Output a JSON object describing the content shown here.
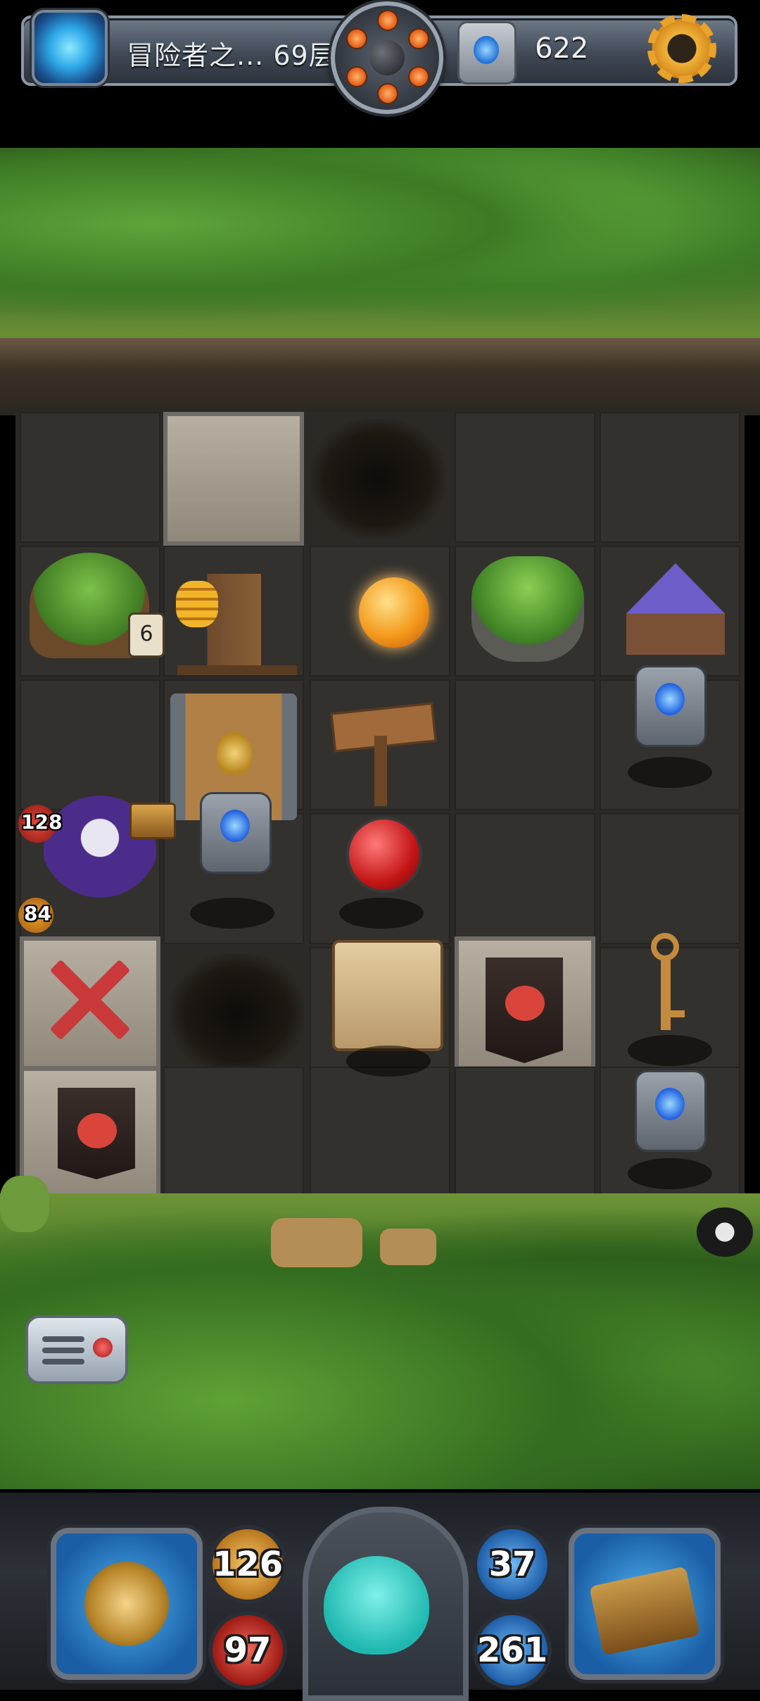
{
  "header": {
    "floor_title": "冒险者之... 69层",
    "gem_count": "622"
  },
  "board": {
    "npc_house_counter": "6",
    "enemy_bat": {
      "attack": "128",
      "hp": "84"
    }
  },
  "hero_stats": {
    "attack": "126",
    "hp": "97",
    "defense": "37",
    "mana": "261"
  },
  "colors": {
    "accent_gold": "#f0b43a",
    "hp_red": "#d62a2a",
    "mana_blue": "#2a7fd6"
  },
  "icons": [
    "portal-icon",
    "bomb-icon",
    "gem-icon",
    "gear-icon",
    "menu-icon",
    "equipment-icon",
    "spellbook-icon",
    "hero-avatar-icon"
  ]
}
